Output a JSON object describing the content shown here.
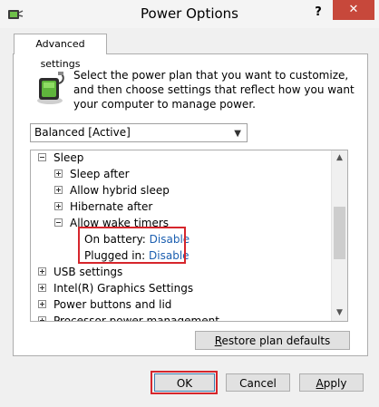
{
  "window": {
    "title": "Power Options",
    "help_label": "?",
    "close_label": "✕"
  },
  "tab": {
    "label": "Advanced settings"
  },
  "description": "Select the power plan that you want to customize, and then choose settings that reflect how you want your computer to manage power.",
  "plan_select": {
    "value": "Balanced [Active]"
  },
  "tree": {
    "sleep": "Sleep",
    "sleep_after": "Sleep after",
    "allow_hybrid_sleep": "Allow hybrid sleep",
    "hibernate_after": "Hibernate after",
    "allow_wake_timers": "Allow wake timers",
    "on_battery_label": "On battery:",
    "on_battery_value": "Disable",
    "plugged_in_label": "Plugged in:",
    "plugged_in_value": "Disable",
    "usb_settings": "USB settings",
    "intel_graphics": "Intel(R) Graphics Settings",
    "power_buttons": "Power buttons and lid",
    "processor_power": "Processor power management"
  },
  "buttons": {
    "restore_r": "R",
    "restore_rest": "estore plan defaults",
    "ok": "OK",
    "cancel": "Cancel",
    "apply_a": "A",
    "apply_rest": "pply"
  },
  "colors": {
    "close": "#c7483b",
    "highlight": "#d6262c",
    "link": "#1c5fb0"
  }
}
